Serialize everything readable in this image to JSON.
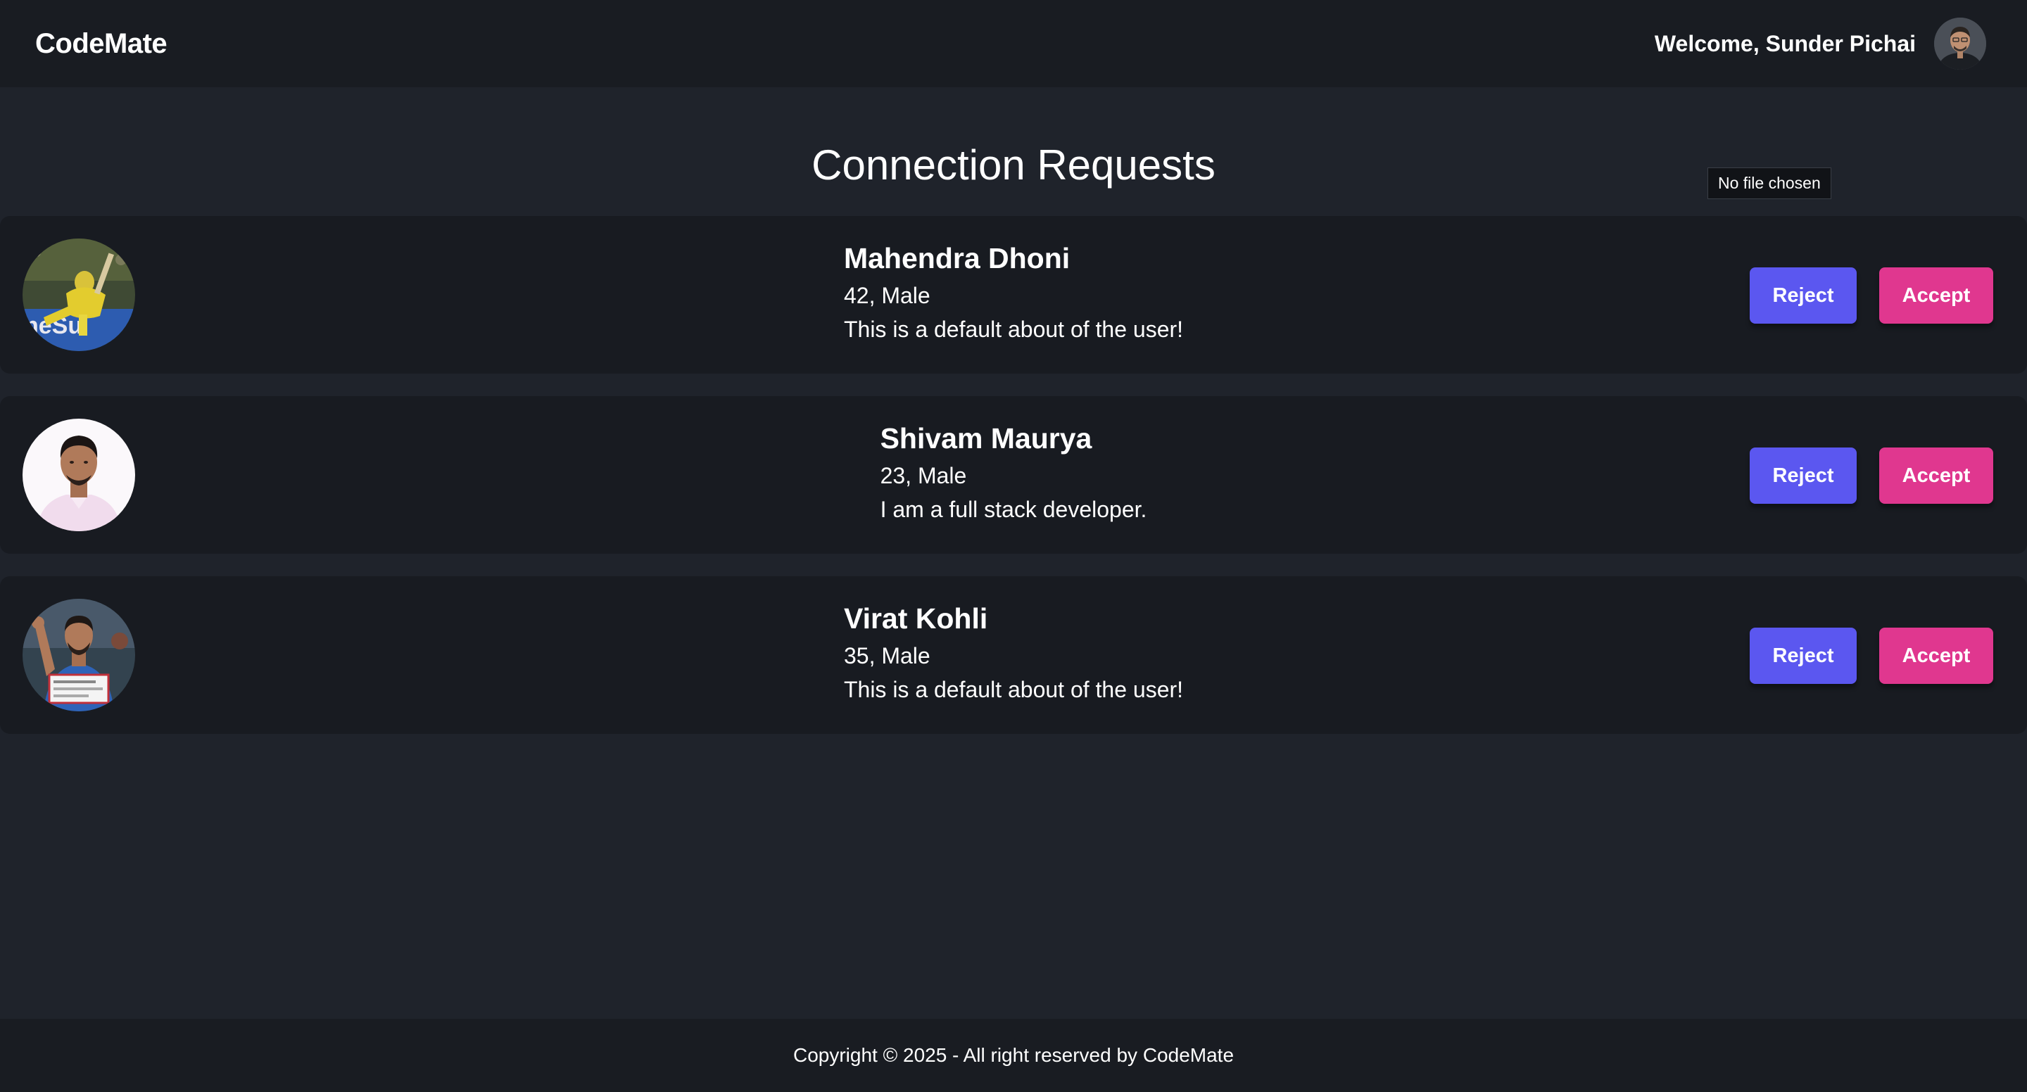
{
  "header": {
    "brand": "CodeMate",
    "welcome": "Welcome, Sunder Pichai"
  },
  "main": {
    "title": "Connection Requests",
    "file_status": "No file chosen",
    "requests": [
      {
        "name": "Mahendra Dhoni",
        "meta": "42, Male",
        "about": "This is a default about of the user!",
        "reject_label": "Reject",
        "accept_label": "Accept"
      },
      {
        "name": "Shivam Maurya",
        "meta": "23, Male",
        "about": "I am a full stack developer.",
        "reject_label": "Reject",
        "accept_label": "Accept"
      },
      {
        "name": "Virat Kohli",
        "meta": "35, Male",
        "about": "This is a default about of the user!",
        "reject_label": "Reject",
        "accept_label": "Accept"
      }
    ]
  },
  "footer": {
    "copyright": "Copyright © 2025 - All right reserved by CodeMate"
  },
  "colors": {
    "background": "#1f232b",
    "navbar": "#191c22",
    "card": "#181b21",
    "reject": "#5b57f0",
    "accept": "#e0378f"
  }
}
